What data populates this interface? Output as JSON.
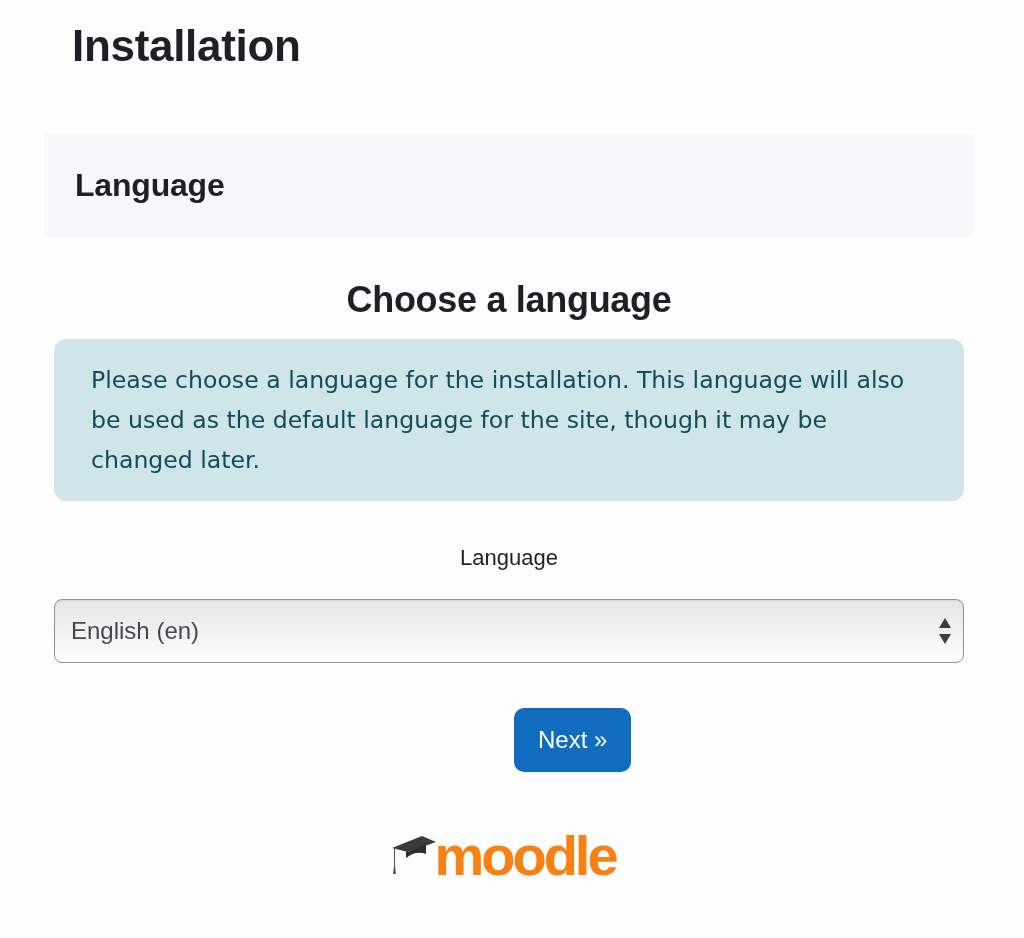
{
  "page": {
    "title": "Installation"
  },
  "section": {
    "heading": "Language"
  },
  "form": {
    "heading": "Choose a language",
    "notice": "Please choose a language for the installation. This language will also be used as the default language for the site, though it may be changed later.",
    "field_label": "Language",
    "select": {
      "value": "English (en)"
    },
    "next_button": {
      "label": "Next »"
    }
  },
  "footer": {
    "logo_text": "moodle"
  }
}
